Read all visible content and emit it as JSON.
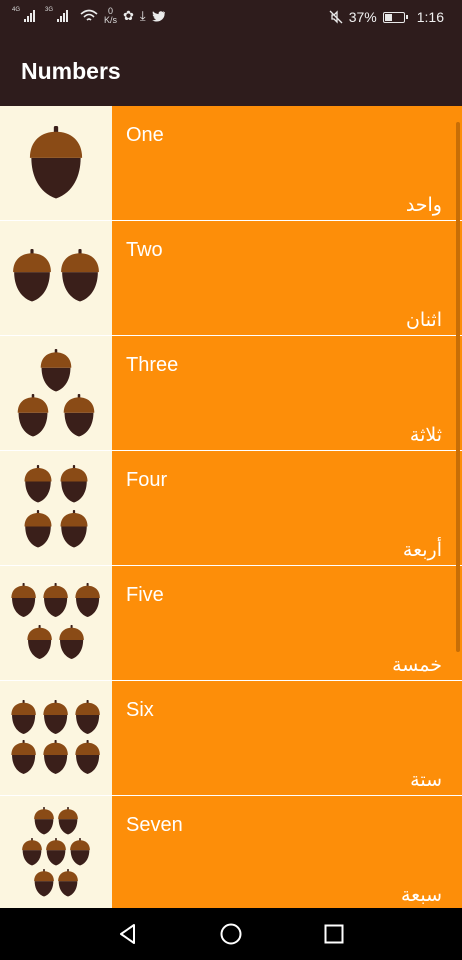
{
  "status_bar": {
    "signal1_tag": "4G",
    "signal2_tag": "3G",
    "net_speed_value": "0",
    "net_speed_unit": "K/s",
    "battery_percent": "37%",
    "time": "1:16",
    "icons": [
      "signal-icon",
      "signal-icon",
      "wifi-icon",
      "paw-icon",
      "download-icon",
      "twitter-icon",
      "mute-icon",
      "battery-icon"
    ]
  },
  "app_bar": {
    "title": "Numbers"
  },
  "numbers": [
    {
      "english": "One",
      "arabic": "واحد",
      "count": 1
    },
    {
      "english": "Two",
      "arabic": "اثنان",
      "count": 2
    },
    {
      "english": "Three",
      "arabic": "ثلاثة",
      "count": 3
    },
    {
      "english": "Four",
      "arabic": "أربعة",
      "count": 4
    },
    {
      "english": "Five",
      "arabic": "خمسة",
      "count": 5
    },
    {
      "english": "Six",
      "arabic": "ستة",
      "count": 6
    },
    {
      "english": "Seven",
      "arabic": "سبعة",
      "count": 7
    }
  ],
  "colors": {
    "app_bar": "#2e1c1c",
    "row_text_bg": "#fd8e09",
    "row_image_bg": "#fcf6e0",
    "acorn_cap": "#8a4b16",
    "acorn_body": "#3a1f1a"
  },
  "nav_bar": {
    "icons": [
      "back-icon",
      "home-icon",
      "recents-icon"
    ]
  }
}
